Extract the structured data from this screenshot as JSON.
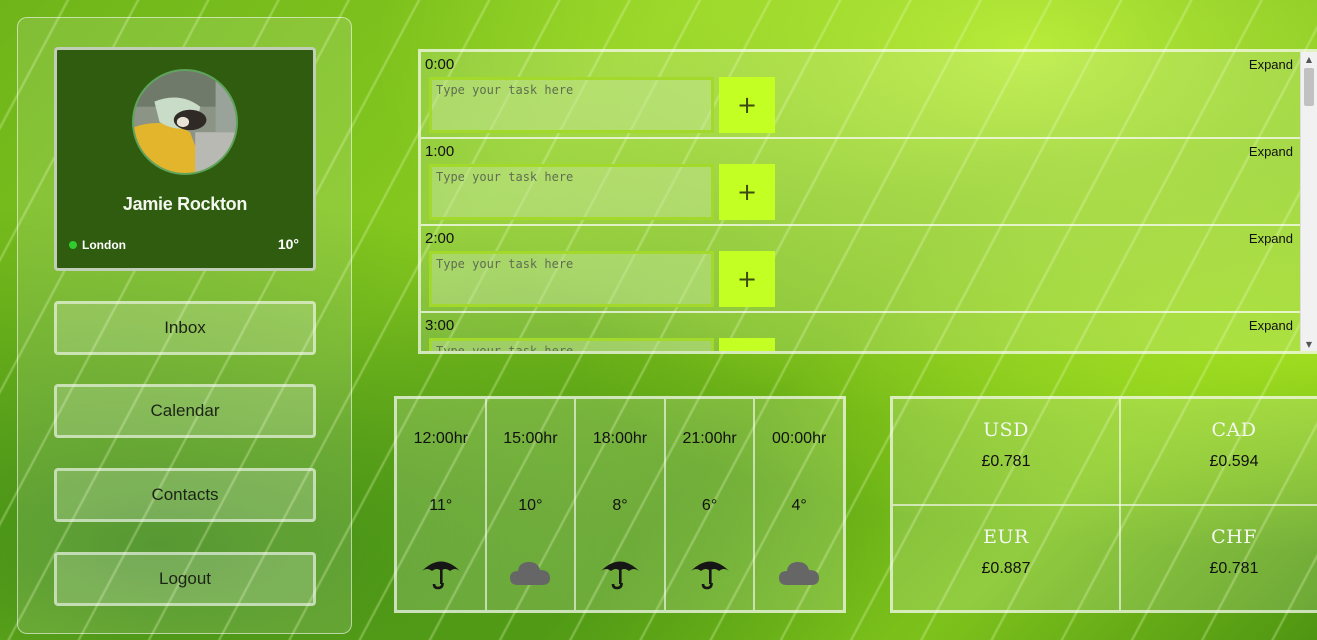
{
  "profile": {
    "name": "Jamie Rockton",
    "location": "London",
    "temperature": "10°"
  },
  "nav": {
    "inbox": "Inbox",
    "calendar": "Calendar",
    "contacts": "Contacts",
    "logout": "Logout"
  },
  "schedule": {
    "expand_label": "Expand",
    "task_placeholder": "Type your task here",
    "add_label": "+",
    "hours": [
      "0:00",
      "1:00",
      "2:00",
      "3:00"
    ]
  },
  "weather": [
    {
      "time": "12:00hr",
      "temp": "11°",
      "icon": "umbrella-icon"
    },
    {
      "time": "15:00hr",
      "temp": "10°",
      "icon": "cloud-icon"
    },
    {
      "time": "18:00hr",
      "temp": "8°",
      "icon": "umbrella-icon"
    },
    {
      "time": "21:00hr",
      "temp": "6°",
      "icon": "umbrella-icon"
    },
    {
      "time": "00:00hr",
      "temp": "4°",
      "icon": "cloud-icon"
    }
  ],
  "currency": [
    {
      "code": "USD",
      "rate": "£0.781"
    },
    {
      "code": "CAD",
      "rate": "£0.594"
    },
    {
      "code": "EUR",
      "rate": "£0.887"
    },
    {
      "code": "CHF",
      "rate": "£0.781"
    }
  ],
  "colors": {
    "accent": "#c4ff24",
    "profile_bg": "#2f5c0f",
    "online": "#2ecc2e"
  }
}
